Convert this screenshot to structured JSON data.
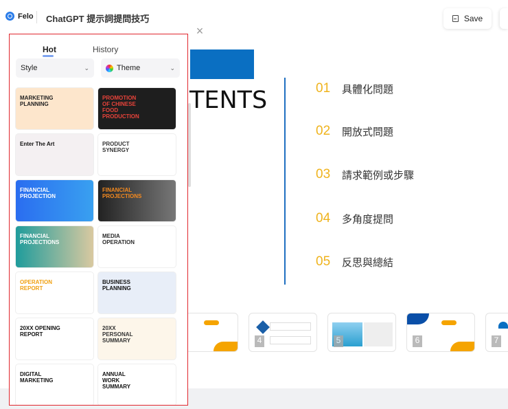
{
  "header": {
    "brand": "Felo",
    "title": "ChatGPT 提示詞提問技巧",
    "save_label": "Save"
  },
  "slide": {
    "heading_fragment": "TENTS",
    "toc": [
      {
        "num": "01",
        "text": "具體化問題"
      },
      {
        "num": "02",
        "text": "開放式問題"
      },
      {
        "num": "03",
        "text": "請求範例或步驟"
      },
      {
        "num": "04",
        "text": "多角度提問"
      },
      {
        "num": "05",
        "text": "反思與總結"
      }
    ],
    "accent": "#0a6fc2",
    "number_color": "#efb31c"
  },
  "thumbnails": [
    {
      "num": "4"
    },
    {
      "num": "5"
    },
    {
      "num": "6"
    },
    {
      "num": "7"
    }
  ],
  "panel": {
    "tabs": [
      "Hot",
      "History"
    ],
    "style_label": "Style",
    "theme_label": "Theme",
    "templates": [
      "MARKETING PLANNING",
      "PROMOTION OF CHINESE FOOD PRODUCTION",
      "Enter The Art",
      "PRODUCT SYNERGY",
      "FINANCIAL PROJECTION",
      "FINANCIAL PROJECTIONS",
      "FINANCIAL PROJECTIONS",
      "MEDIA OPERATION",
      "OPERATION REPORT",
      "BUSINESS PLANNING",
      "20XX OPENING REPORT",
      "20XX PERSONAL SUMMARY",
      "DIGITAL MARKETING",
      "ANNUAL WORK SUMMARY"
    ]
  }
}
